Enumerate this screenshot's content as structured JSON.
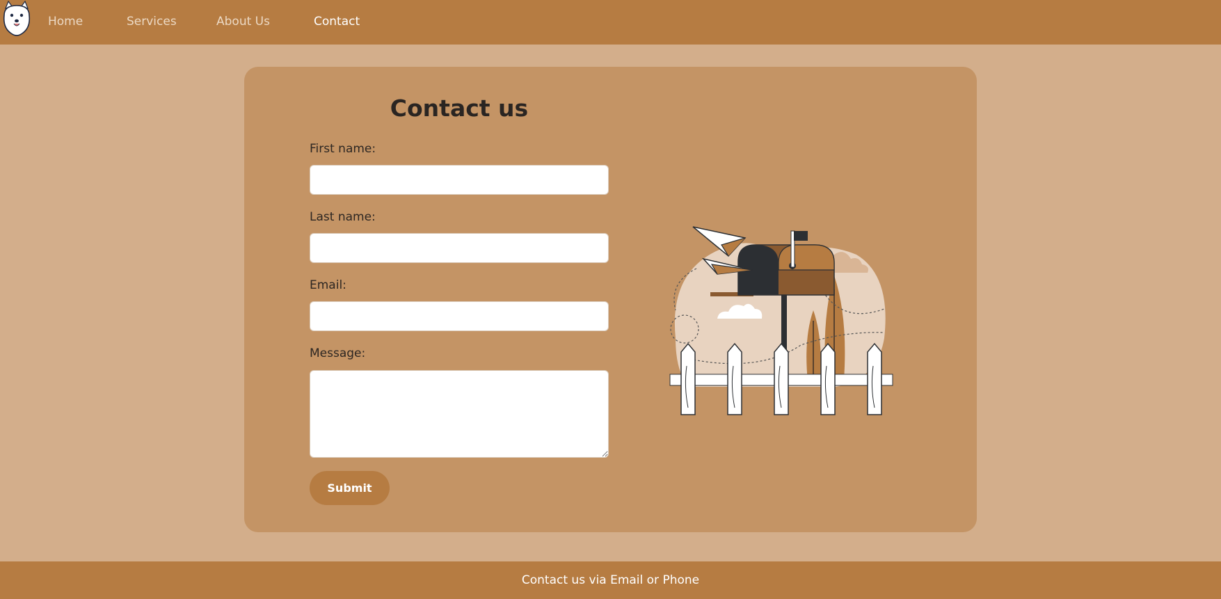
{
  "nav": {
    "links": [
      {
        "label": "Home"
      },
      {
        "label": "Services"
      },
      {
        "label": "About Us"
      },
      {
        "label": "Contact",
        "active": true
      }
    ]
  },
  "form": {
    "title": "Contact us",
    "first_name_label": "First name:",
    "first_name_value": "",
    "last_name_label": "Last name:",
    "last_name_value": "",
    "email_label": "Email:",
    "email_value": "",
    "message_label": "Message:",
    "message_value": "",
    "submit_label": "Submit"
  },
  "illustration": {
    "icon": "mailbox-illustration"
  },
  "footer": {
    "text": "Contact us via Email or Phone"
  },
  "colors": {
    "page_bg": "#d3ae8b",
    "nav_bg": "#b67c42",
    "card_bg": "#c49465",
    "button_bg": "#b67c42",
    "text_dark": "#2c2622"
  }
}
